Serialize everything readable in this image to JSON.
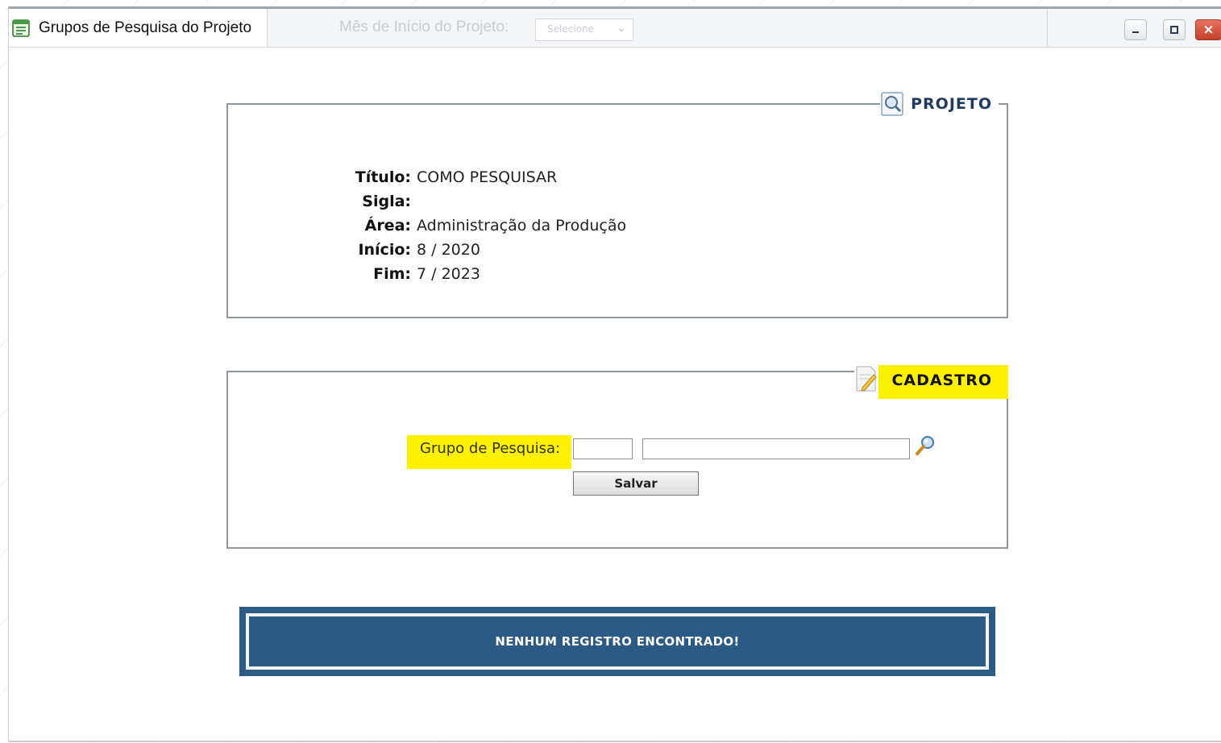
{
  "window": {
    "title": "Grupos de Pesquisa do Projeto",
    "background_label": "Mês de Início do Projeto:",
    "background_select_value": "Selecione"
  },
  "projeto": {
    "legend": "PROJETO",
    "fields": [
      {
        "label": "Título:",
        "value": "COMO PESQUISAR"
      },
      {
        "label": "Sigla:",
        "value": ""
      },
      {
        "label": "Área:",
        "value": "Administração da Produção"
      },
      {
        "label": "Início:",
        "value": "8 / 2020"
      },
      {
        "label": "Fim:",
        "value": "7 / 2023"
      }
    ]
  },
  "cadastro": {
    "legend": "CADASTRO",
    "grupo_label": "Grupo de Pesquisa:",
    "code_value": "",
    "name_value": "",
    "save_label": "Salvar"
  },
  "message": "NENHUM REGISTRO ENCONTRADO!",
  "colors": {
    "highlight": "#fff200",
    "message_bg": "#2b5a86",
    "legend_text": "#1f3a5f"
  }
}
